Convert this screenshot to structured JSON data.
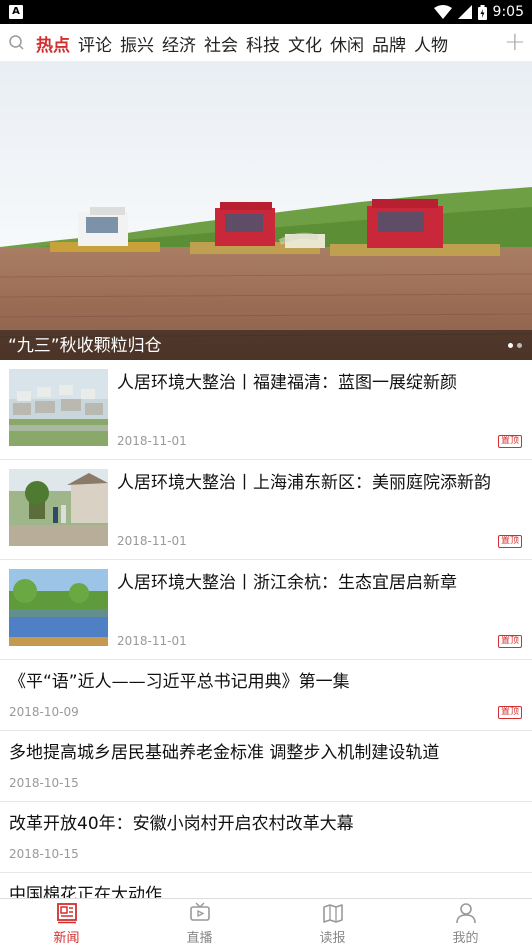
{
  "status_bar": {
    "time": "9:05"
  },
  "nav": {
    "tabs": [
      "热点",
      "评论",
      "振兴",
      "经济",
      "社会",
      "科技",
      "文化",
      "休闲",
      "品牌",
      "人物"
    ],
    "active_index": 0
  },
  "banner": {
    "caption": "“九三”秋收颗粒归仓"
  },
  "badge_label": "置顶",
  "news": [
    {
      "title": "人居环境大整治丨福建福清：蓝图一展绽新颜",
      "date": "2018-11-01",
      "pinned": true
    },
    {
      "title": "人居环境大整治丨上海浦东新区：美丽庭院添新韵",
      "date": "2018-11-01",
      "pinned": true
    },
    {
      "title": "人居环境大整治丨浙江余杭：生态宜居启新章",
      "date": "2018-11-01",
      "pinned": true
    },
    {
      "title": "《平“语”近人——习近平总书记用典》第一集",
      "date": "2018-10-09",
      "pinned": true
    },
    {
      "title": "多地提高城乡居民基础养老金标准 调整步入机制建设轨道",
      "date": "2018-10-15",
      "pinned": false
    },
    {
      "title": "改革开放40年：安徽小岗村开启农村改革大幕",
      "date": "2018-10-15",
      "pinned": false
    },
    {
      "title": "中国棉花正在大动作",
      "date": "",
      "pinned": false
    }
  ],
  "bottom_tabs": [
    {
      "label": "新闻",
      "icon": "news-icon",
      "active": true
    },
    {
      "label": "直播",
      "icon": "tv-icon",
      "active": false
    },
    {
      "label": "读报",
      "icon": "newspaper-icon",
      "active": false
    },
    {
      "label": "我的",
      "icon": "user-icon",
      "active": false
    }
  ],
  "colors": {
    "accent": "#d32f2f"
  }
}
